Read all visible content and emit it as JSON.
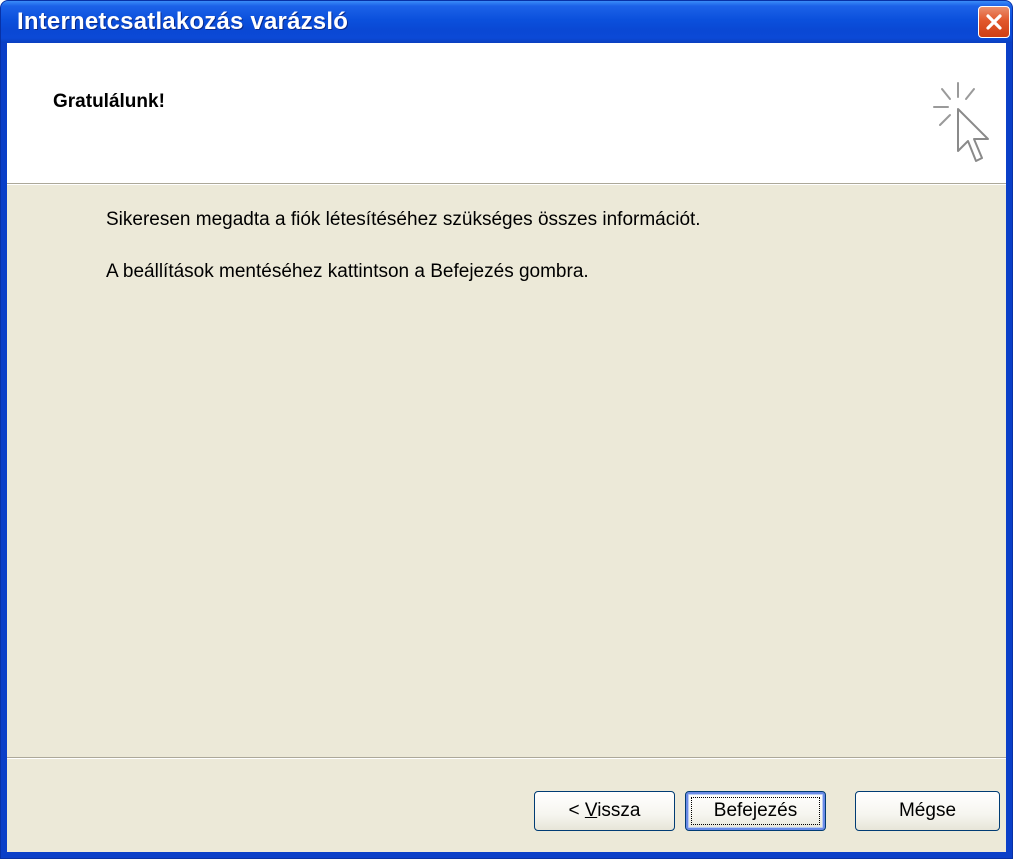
{
  "window": {
    "title": "Internetcsatlakozás varázsló"
  },
  "header": {
    "title": "Gratulálunk!"
  },
  "body": {
    "line1": "Sikeresen megadta a fiók létesítéséhez szükséges összes információt.",
    "line2": "A beállítások mentéséhez kattintson a Befejezés gombra."
  },
  "buttons": {
    "back_prefix": "< ",
    "back_mnemonic": "V",
    "back_rest": "issza",
    "finish": "Befejezés",
    "cancel": "Mégse"
  },
  "icons": {
    "close": "close-icon",
    "wizard": "cursor-sparkle-icon"
  },
  "colors": {
    "titlebar": "#0b50dc",
    "close_button": "#e2582c",
    "dialog_background": "#ece9d8",
    "header_background": "#ffffff"
  }
}
